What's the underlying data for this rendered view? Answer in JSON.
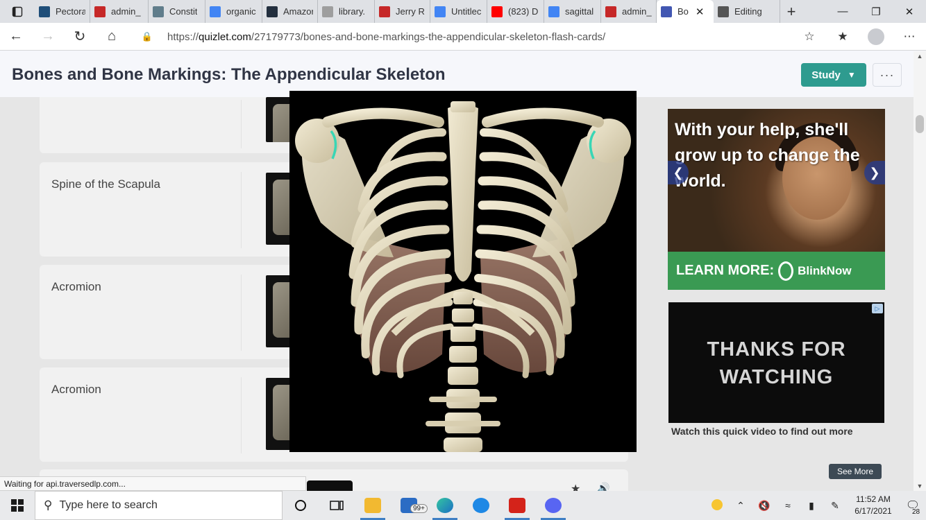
{
  "browser": {
    "tabs": [
      {
        "label": "Pectora",
        "favicon": "#1f4e79",
        "icon": "image-favicon"
      },
      {
        "label": "admin_",
        "favicon": "#c62828",
        "icon": "pdf-favicon"
      },
      {
        "label": "Constit",
        "favicon": "#607d8b",
        "icon": "image-favicon"
      },
      {
        "label": "organic",
        "favicon": "#4285f4",
        "icon": "google-favicon"
      },
      {
        "label": "Amazor",
        "favicon": "#232f3e",
        "icon": "amazon-favicon"
      },
      {
        "label": "library.",
        "favicon": "#9e9e9e",
        "icon": "page-favicon"
      },
      {
        "label": "Jerry R",
        "favicon": "#c62828",
        "icon": "pdf-favicon"
      },
      {
        "label": "Untitlec",
        "favicon": "#4285f4",
        "icon": "docs-favicon"
      },
      {
        "label": "(823) D",
        "favicon": "#ff0000",
        "icon": "youtube-favicon"
      },
      {
        "label": "sagittal",
        "favicon": "#4285f4",
        "icon": "google-favicon"
      },
      {
        "label": "admin_",
        "favicon": "#c62828",
        "icon": "pdf-favicon"
      },
      {
        "label": "Bo",
        "favicon": "#4257b2",
        "icon": "quizlet-favicon",
        "active": true
      },
      {
        "label": "Editing",
        "favicon": "#555555",
        "icon": "edit-favicon"
      }
    ],
    "url_prefix": "https://",
    "url_host": "quizlet.com",
    "url_path": "/27179773/bones-and-bone-markings-the-appendicular-skeleton-flash-cards/"
  },
  "page": {
    "title": "Bones and Bone Markings: The Appendicular Skeleton",
    "study_label": "Study",
    "more_label": "···"
  },
  "cards": [
    {
      "term": "",
      "top": 0
    },
    {
      "term": "Spine of the Scapula"
    },
    {
      "term": "Acromion"
    },
    {
      "term": "Acromion"
    }
  ],
  "ads": {
    "donation": {
      "headline": "With your help, she'll grow up to change the world.",
      "cta": "LEARN MORE:",
      "brand": "BlinkNow"
    },
    "video": {
      "overlay_text": "THANKS FOR WATCHING",
      "caption": "Watch this quick video to find out more",
      "see_more": "See More"
    }
  },
  "status": "Waiting for api.traversedlp.com...",
  "taskbar": {
    "search_placeholder": "Type here to search",
    "mail_count": "99+",
    "time": "11:52 AM",
    "date": "6/17/2021",
    "notifications": "28"
  },
  "colors": {
    "accent": "#2e9b8f",
    "quizlet": "#4257b2",
    "ad_green": "#3a9a53"
  }
}
